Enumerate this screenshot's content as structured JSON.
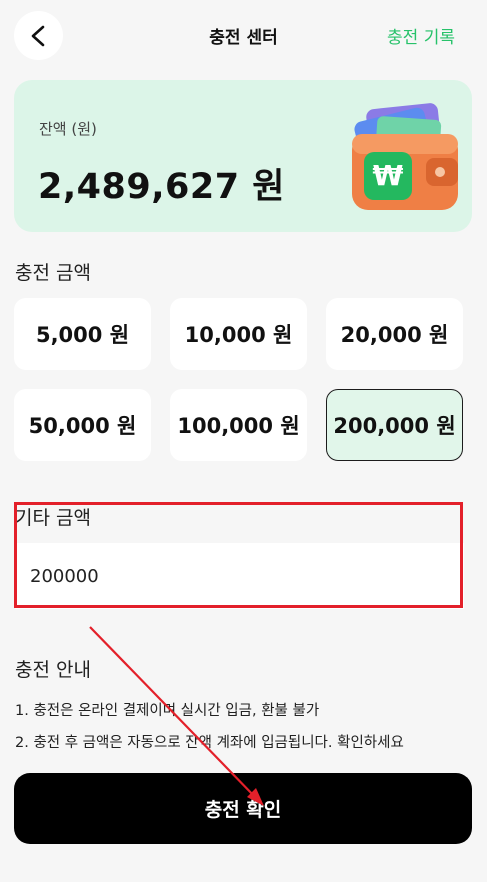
{
  "header": {
    "title": "충전 센터",
    "history_link": "충전 기록",
    "back_icon": "chevron-left-icon"
  },
  "balance": {
    "label": "잔액 (원)",
    "value": "2,489,627 원",
    "illustration": "wallet-icon",
    "currency_symbol": "₩"
  },
  "amounts": {
    "label": "충전 금액",
    "options": [
      {
        "label": "5,000 원",
        "selected": false
      },
      {
        "label": "10,000 원",
        "selected": false
      },
      {
        "label": "20,000 원",
        "selected": false
      },
      {
        "label": "50,000 원",
        "selected": false
      },
      {
        "label": "100,000 원",
        "selected": false
      },
      {
        "label": "200,000 원",
        "selected": true
      }
    ]
  },
  "custom": {
    "label": "기타 금액",
    "value": "200000"
  },
  "guide": {
    "title": "충전 안내",
    "lines": [
      "1. 충전은 온라인 결제이며 실시간 입금, 환불 불가",
      "2. 충전 후 금액은 자동으로 잔액 계좌에 입금됩니다. 확인하세요"
    ]
  },
  "confirm": {
    "label": "충전 확인"
  },
  "colors": {
    "accent_green": "#27c26a",
    "card_background": "#dcf5e8",
    "annotation_red": "#e3202a"
  }
}
